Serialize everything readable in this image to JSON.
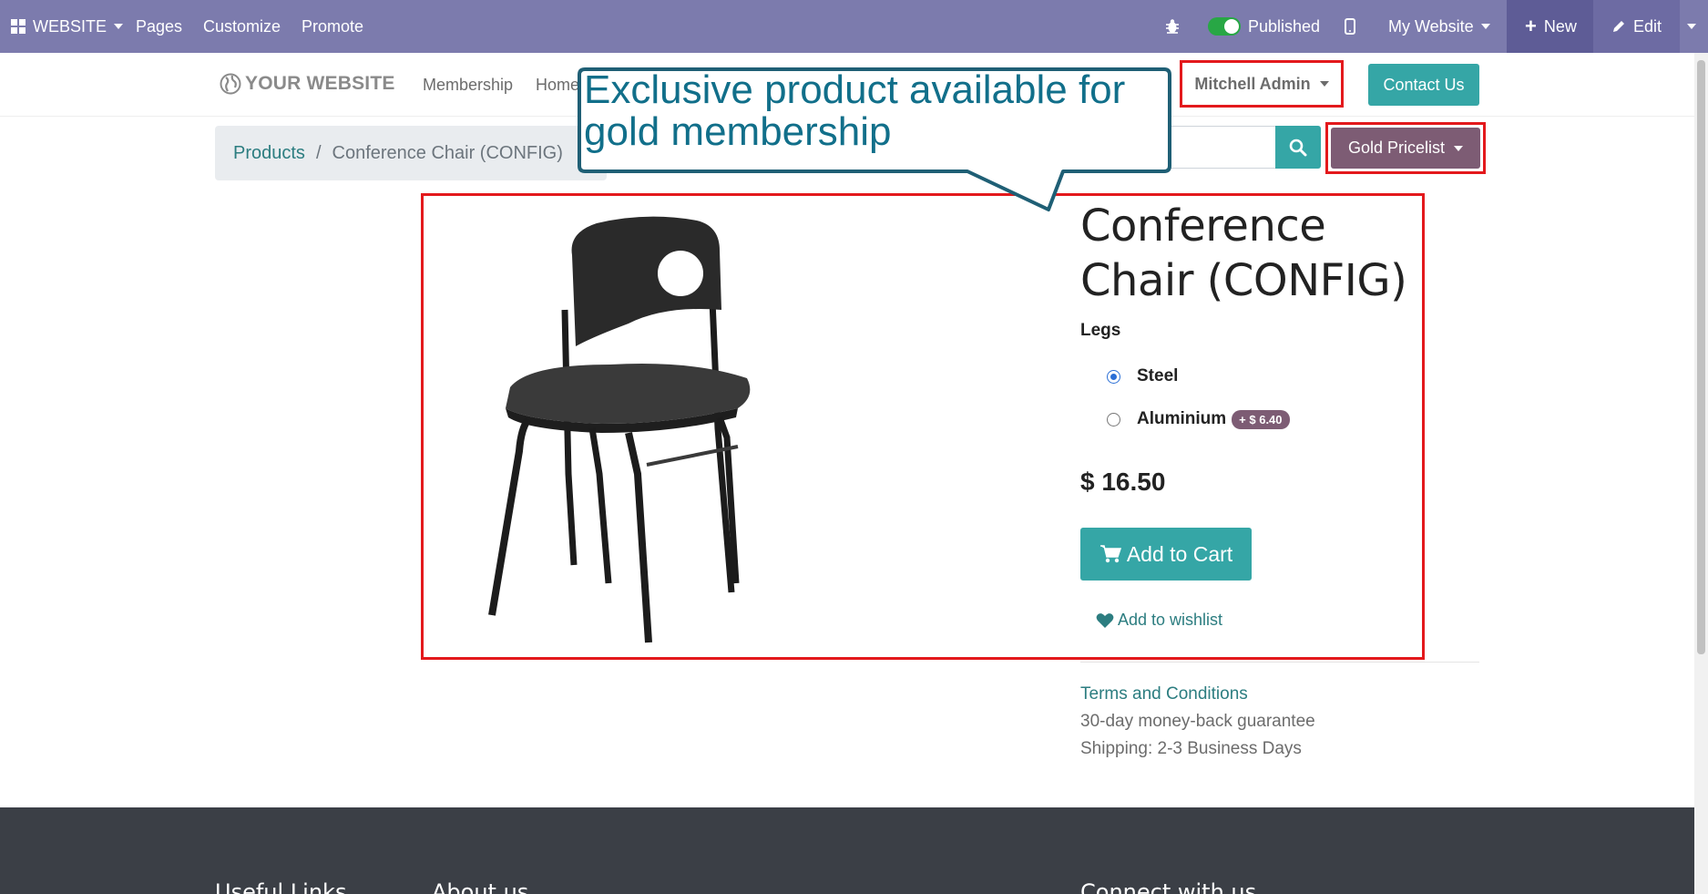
{
  "topbar": {
    "app_menu_label": "WEBSITE",
    "pages_label": "Pages",
    "customize_label": "Customize",
    "promote_label": "Promote",
    "published_label": "Published",
    "published": true,
    "website_switch_label": "My Website",
    "new_label": "New",
    "edit_label": "Edit"
  },
  "header": {
    "logo_text": "YOUR WEBSITE",
    "nav_items": [
      "Membership",
      "Home"
    ],
    "user_name": "Mitchell Admin",
    "contact_label": "Contact Us"
  },
  "breadcrumb": {
    "root": "Products",
    "separator": "/",
    "current": "Conference Chair (CONFIG)"
  },
  "pricelist": {
    "selected": "Gold Pricelist"
  },
  "callout": {
    "text": "Exclusive product available for gold membership"
  },
  "product": {
    "title": "Conference Chair (CONFIG)",
    "attribute_label": "Legs",
    "options": [
      {
        "label": "Steel",
        "checked": true,
        "extra": ""
      },
      {
        "label": "Aluminium",
        "checked": false,
        "extra": "+ $ 6.40"
      }
    ],
    "price": "$ 16.50",
    "add_to_cart_label": "Add to Cart",
    "wishlist_label": "Add to wishlist",
    "terms_label": "Terms and Conditions",
    "guarantee": "30-day money-back guarantee",
    "shipping": "Shipping: 2-3 Business Days"
  },
  "footer": {
    "headings": [
      "Useful Links",
      "About us",
      "Connect with us"
    ]
  },
  "colors": {
    "topbar": "#7c7bad",
    "accent_teal": "#35a6a6",
    "pricelist_purple": "#7d5c74",
    "highlight_red": "#e3191c",
    "callout_blue": "#116f8a"
  }
}
